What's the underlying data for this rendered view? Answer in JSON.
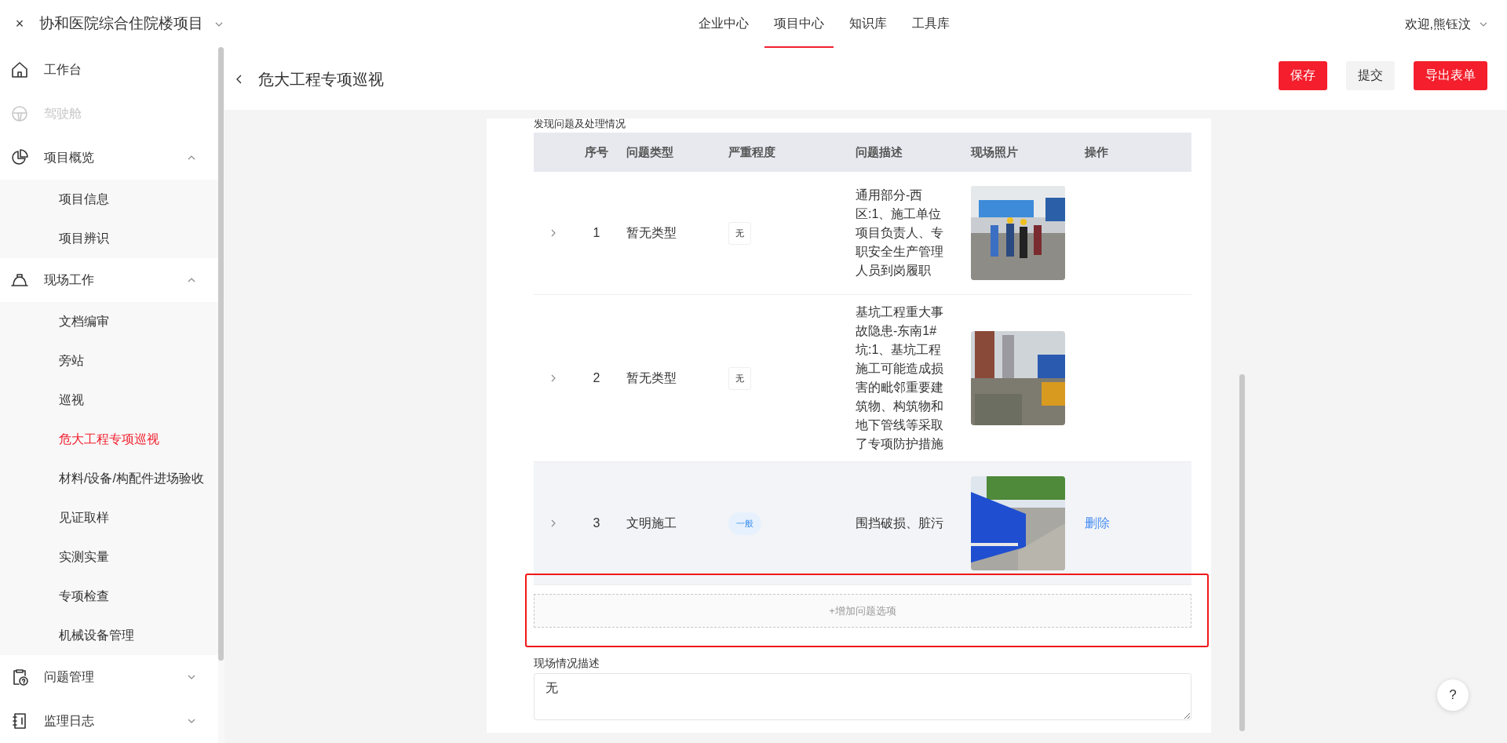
{
  "topbar": {
    "close": "×",
    "project": "协和医院综合住院楼项目",
    "nav": [
      {
        "label": "企业中心",
        "selected": false
      },
      {
        "label": "项目中心",
        "selected": true
      },
      {
        "label": "知识库",
        "selected": false
      },
      {
        "label": "工具库",
        "selected": false
      }
    ],
    "user": "欢迎,熊钰汶"
  },
  "sidebar": {
    "items": [
      {
        "label": "工作台",
        "kind": "home",
        "disabled": false
      },
      {
        "label": "驾驶舱",
        "kind": "wheel",
        "disabled": true
      },
      {
        "label": "项目概览",
        "kind": "pie",
        "disabled": false,
        "expanded": true,
        "children": [
          {
            "label": "项目信息",
            "selected": false
          },
          {
            "label": "项目辨识",
            "selected": false
          }
        ]
      },
      {
        "label": "现场工作",
        "kind": "helmet",
        "disabled": false,
        "expanded": true,
        "children": [
          {
            "label": "文档编审",
            "selected": false
          },
          {
            "label": "旁站",
            "selected": false
          },
          {
            "label": "巡视",
            "selected": false
          },
          {
            "label": "危大工程专项巡视",
            "selected": true
          },
          {
            "label": "材料/设备/构配件进场验收",
            "selected": false
          },
          {
            "label": "见证取样",
            "selected": false
          },
          {
            "label": "实测实量",
            "selected": false
          },
          {
            "label": "专项检查",
            "selected": false
          },
          {
            "label": "机械设备管理",
            "selected": false
          }
        ]
      },
      {
        "label": "问题管理",
        "kind": "clipboard",
        "disabled": false,
        "expanded": false
      },
      {
        "label": "监理日志",
        "kind": "book",
        "disabled": false,
        "expanded": false
      }
    ]
  },
  "page": {
    "title": "危大工程专项巡视",
    "buttons": [
      {
        "label": "保存",
        "kind": "primary"
      },
      {
        "label": "提交",
        "kind": "default"
      },
      {
        "label": "导出表单",
        "kind": "primary"
      }
    ]
  },
  "issues": {
    "title": "发现问题及处理情况",
    "columns": [
      "序号",
      "问题类型",
      "严重程度",
      "问题描述",
      "现场照片",
      "操作"
    ],
    "rows": [
      {
        "no": "1",
        "type": "暂无类型",
        "severity": {
          "text": "无",
          "kind": "plain"
        },
        "description": "通用部分-西区:1、施工单位项目负责人、专职安全生产管理人员到岗履职",
        "selected": false
      },
      {
        "no": "2",
        "type": "暂无类型",
        "severity": {
          "text": "无",
          "kind": "plain"
        },
        "description": "基坑工程重大事故隐患-东南1#坑:1、基坑工程施工可能造成损害的毗邻重要建筑物、构筑物和地下管线等采取了专项防护措施",
        "selected": false
      },
      {
        "no": "3",
        "type": "文明施工",
        "severity": {
          "text": "一般",
          "kind": "info"
        },
        "description": "围挡破损、脏污",
        "selected": true,
        "action": "删除"
      }
    ],
    "add_button": "+增加问题选项"
  },
  "site_description": {
    "label": "现场情况描述",
    "value": "无"
  },
  "help": "?"
}
